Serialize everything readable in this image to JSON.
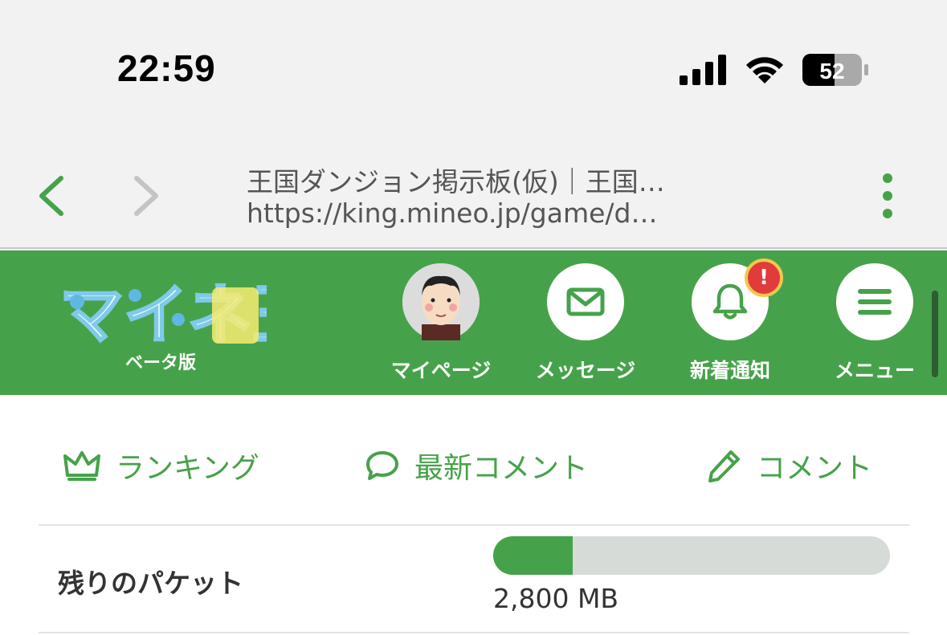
{
  "status_bar": {
    "time": "22:59",
    "battery_level": "52",
    "icons": [
      "signal-icon",
      "wifi-icon",
      "battery-icon"
    ]
  },
  "browser": {
    "page_title": "王国ダンジョン掲示板(仮)｜王国…",
    "url": "https://king.mineo.jp/game/d…",
    "icons": [
      "back-icon",
      "forward-icon",
      "more-vert-icon"
    ]
  },
  "header": {
    "logo_text": "マイネ王",
    "logo_sub": "ベータ版",
    "nav": [
      {
        "label": "マイページ",
        "icon": "avatar"
      },
      {
        "label": "メッセージ",
        "icon": "mail-icon"
      },
      {
        "label": "新着通知",
        "icon": "bell-icon",
        "badge": "!"
      },
      {
        "label": "メニュー",
        "icon": "hamburger-icon"
      }
    ]
  },
  "tabs": [
    {
      "label": "ランキング",
      "icon": "crown-icon"
    },
    {
      "label": "最新コメント",
      "icon": "speech-bubble-icon"
    },
    {
      "label": "コメント",
      "icon": "pencil-icon"
    }
  ],
  "packet": {
    "label": "残りのパケット",
    "value": "2,800 MB",
    "progress_fraction": 0.2
  },
  "colors": {
    "brand_green": "#46a24a",
    "badge_red": "#e23b3b",
    "badge_ring": "#f2c94c",
    "track_gray": "#d6dbd7"
  }
}
